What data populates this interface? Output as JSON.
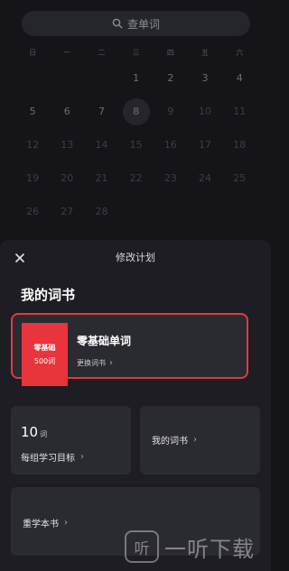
{
  "search": {
    "placeholder": "查单词"
  },
  "calendar": {
    "weekdays": [
      "日",
      "一",
      "二",
      "三",
      "四",
      "五",
      "六"
    ],
    "weeks": [
      [
        "",
        "",
        "",
        "1",
        "2",
        "3",
        "4"
      ],
      [
        "5",
        "6",
        "7",
        "8",
        "9",
        "10",
        "11"
      ],
      [
        "12",
        "13",
        "14",
        "15",
        "16",
        "17",
        "18"
      ],
      [
        "19",
        "20",
        "21",
        "22",
        "23",
        "24",
        "25"
      ],
      [
        "26",
        "27",
        "28",
        "",
        "",
        "",
        ""
      ]
    ],
    "today": "8"
  },
  "sheet": {
    "title": "修改计划",
    "section_title": "我的词书",
    "current_book": {
      "cover_line1": "零基础",
      "cover_line2": "500词",
      "name": "零基础单词",
      "change_label": "更换词书"
    },
    "goal": {
      "count": "10",
      "unit": "词",
      "label": "每组学习目标"
    },
    "my_books_label": "我的词书",
    "restart_label": "重学本书"
  },
  "watermark": {
    "text": "一听下载",
    "logo_glyph": "听"
  },
  "colors": {
    "accent_red": "#e13b3f",
    "cover_red": "#e8343a",
    "sheet_bg": "#1d1d23",
    "card_bg": "#2a2a31"
  },
  "icons": {
    "search": "search-icon",
    "close": "close-icon",
    "chevron": "chevron-right-icon"
  }
}
